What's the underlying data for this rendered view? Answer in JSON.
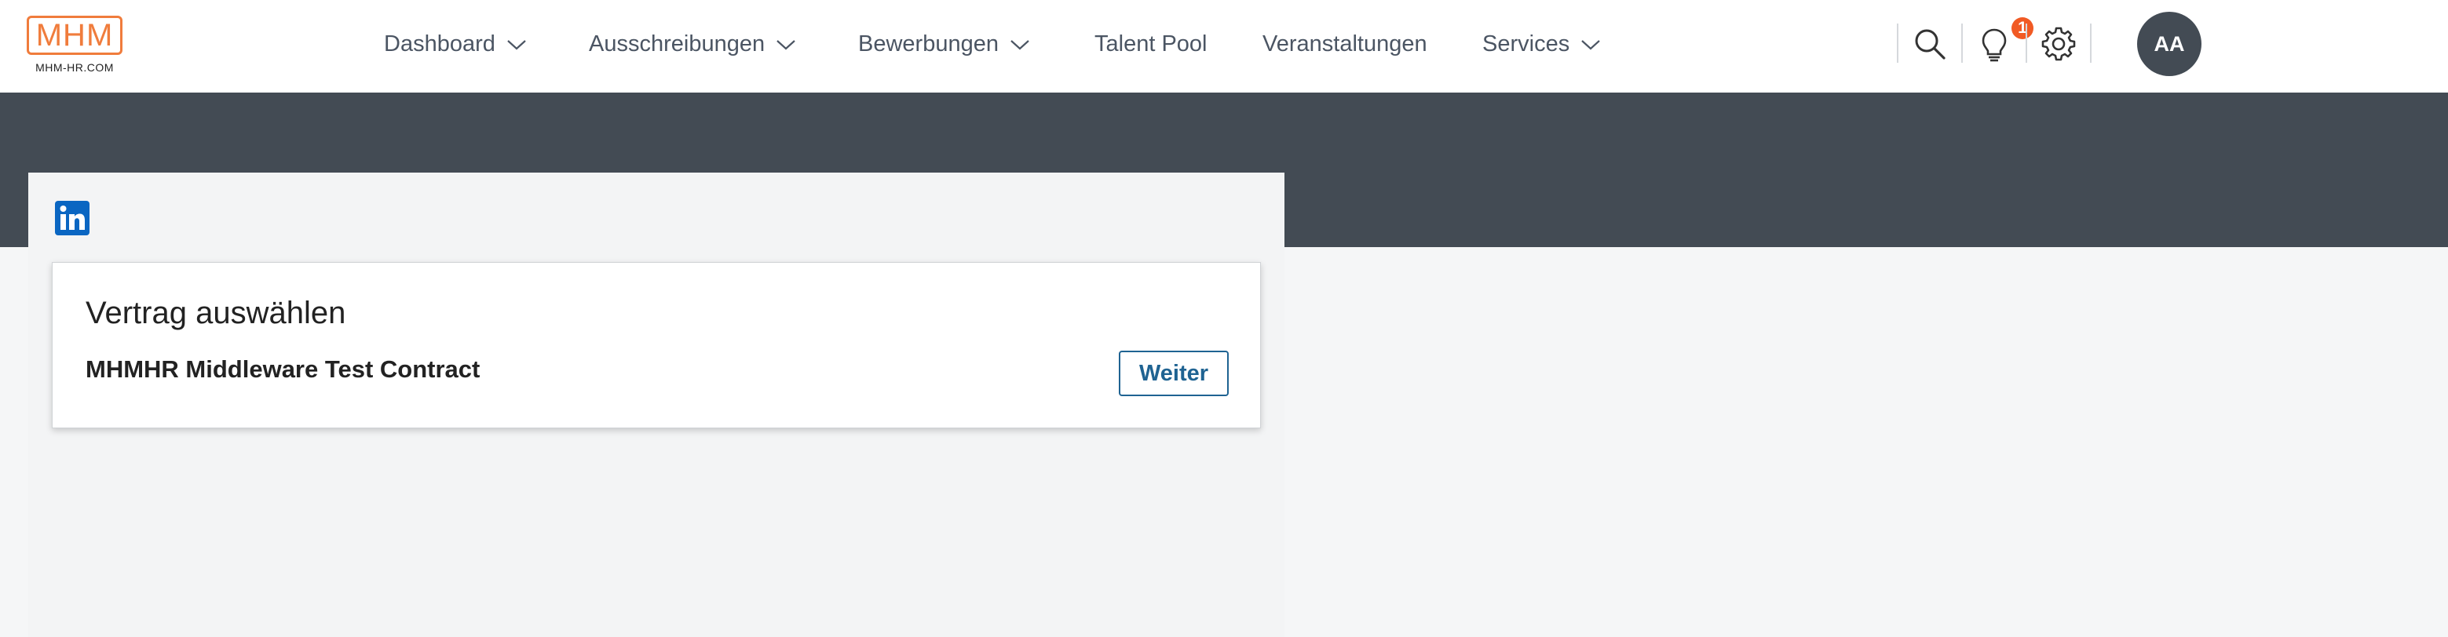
{
  "header": {
    "logo_text": "MHM",
    "logo_subtext": "MHM-HR.COM",
    "nav": [
      {
        "label": "Dashboard",
        "has_dropdown": true
      },
      {
        "label": "Ausschreibungen",
        "has_dropdown": true
      },
      {
        "label": "Bewerbungen",
        "has_dropdown": true
      },
      {
        "label": "Talent Pool",
        "has_dropdown": false
      },
      {
        "label": "Veranstaltungen",
        "has_dropdown": false
      },
      {
        "label": "Services",
        "has_dropdown": true
      }
    ],
    "icons": [
      "search-icon",
      "lightbulb-icon",
      "gear-icon"
    ],
    "notification_count": "1",
    "avatar_initials": "AA"
  },
  "panel": {
    "linkedin_icon": "linkedin-icon"
  },
  "contract_card": {
    "title": "Vertrag auswählen",
    "contract_name": "MHMHR Middleware Test Contract",
    "button_label": "Weiter"
  },
  "colors": {
    "brand_orange": "#f07c3c",
    "hero_dark": "#434b54",
    "accent_blue": "#1f6392",
    "badge_red": "#f15a24"
  }
}
